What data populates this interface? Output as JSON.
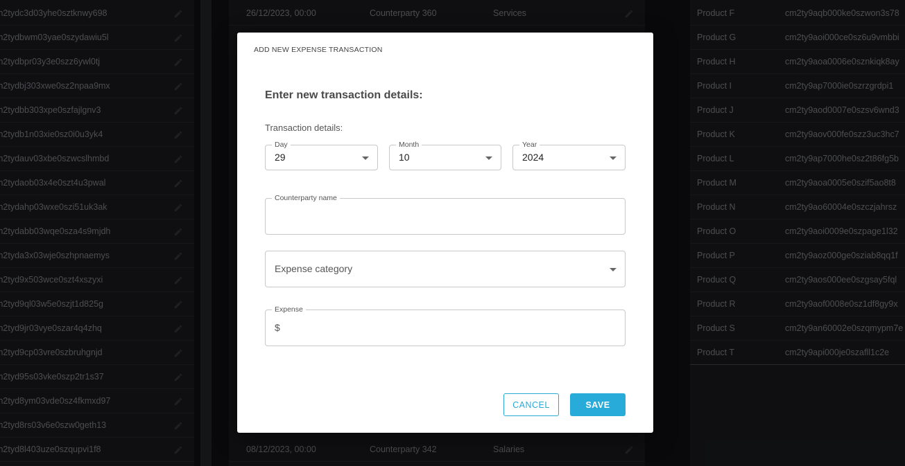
{
  "background": {
    "left_rows": [
      "m2tydc3d03yhe0sztknwy698",
      "m2tydbwm03yae0szydawiu5l",
      "m2tydbpr03y3e0szz6ywl0tj",
      "m2tydbj303xwe0sz2npaa9mx",
      "m2tydbb303xpe0szfajlgnv3",
      "m2tydb1n03xie0sz0i0u3yk4",
      "m2tydauv03xbe0szwcslhmbd",
      "m2tydaob03x4e0szt4u3pwal",
      "m2tydahp03wxe0szi51uk3ak",
      "m2tydabb03wqe0sza4s9mjdh",
      "m2tyda3x03wje0szhpnaemys",
      "m2tyd9x503wce0szt4xszyxi",
      "m2tyd9ql03w5e0szjt1d825g",
      "m2tyd9jr03vye0szar4q4zhq",
      "m2tyd9cp03vre0szbruhgnjd",
      "m2tyd95s03vke0szp2tr1s37",
      "m2tyd8ym03vde0sz4fkmxd97",
      "m2tyd8rs03v6e0szw0geth13",
      "m2tyd8l403uze0szqupvi1f8"
    ],
    "mid_top": {
      "date": "26/12/2023, 00:00",
      "counterparty": "Counterparty 360",
      "category": "Services"
    },
    "mid_bottom": {
      "date": "08/12/2023, 00:00",
      "counterparty": "Counterparty 342",
      "category": "Salaries"
    },
    "right_rows": [
      {
        "name": "Product F",
        "id": "cm2ty9aqb000ke0szwon3s78"
      },
      {
        "name": "Product G",
        "id": "cm2ty9aoi000ce0sz6u9vmbbi"
      },
      {
        "name": "Product H",
        "id": "cm2ty9aoa0006e0sznkiqk8ay"
      },
      {
        "name": "Product I",
        "id": "cm2ty9ap7000ie0szrzgrdpi1"
      },
      {
        "name": "Product J",
        "id": "cm2ty9aod0007e0szsv6wnd3"
      },
      {
        "name": "Product K",
        "id": "cm2ty9aov000fe0szz3uc3hc7"
      },
      {
        "name": "Product L",
        "id": "cm2ty9ap7000he0sz2t86fg5b"
      },
      {
        "name": "Product M",
        "id": "cm2ty9aoa0005e0szif5ao8t8"
      },
      {
        "name": "Product N",
        "id": "cm2ty9ao60004e0szczjahrsz"
      },
      {
        "name": "Product O",
        "id": "cm2ty9aoi0009e0szpage1l32"
      },
      {
        "name": "Product P",
        "id": "cm2ty9aoz000ge0sziab8qq1f"
      },
      {
        "name": "Product Q",
        "id": "cm2ty9aos000ee0szgsay5fql"
      },
      {
        "name": "Product R",
        "id": "cm2ty9aof0008e0sz1df8gy9x"
      },
      {
        "name": "Product S",
        "id": "cm2ty9an60002e0szqmypm7e"
      },
      {
        "name": "Product T",
        "id": "cm2ty9api000je0szafll1c2e"
      }
    ]
  },
  "modal": {
    "title": "ADD NEW EXPENSE TRANSACTION",
    "heading": "Enter new transaction details:",
    "details_label": "Transaction details:",
    "day": {
      "label": "Day",
      "value": "29"
    },
    "month": {
      "label": "Month",
      "value": "10"
    },
    "year": {
      "label": "Year",
      "value": "2024"
    },
    "counterparty": {
      "label": "Counterparty name",
      "value": ""
    },
    "category": {
      "placeholder": "Expense category"
    },
    "expense": {
      "label": "Expense",
      "prefix": "$",
      "value": ""
    },
    "cancel_label": "CANCEL",
    "save_label": "SAVE"
  },
  "colors": {
    "accent": "#29abd9",
    "backdrop": "#111214"
  }
}
